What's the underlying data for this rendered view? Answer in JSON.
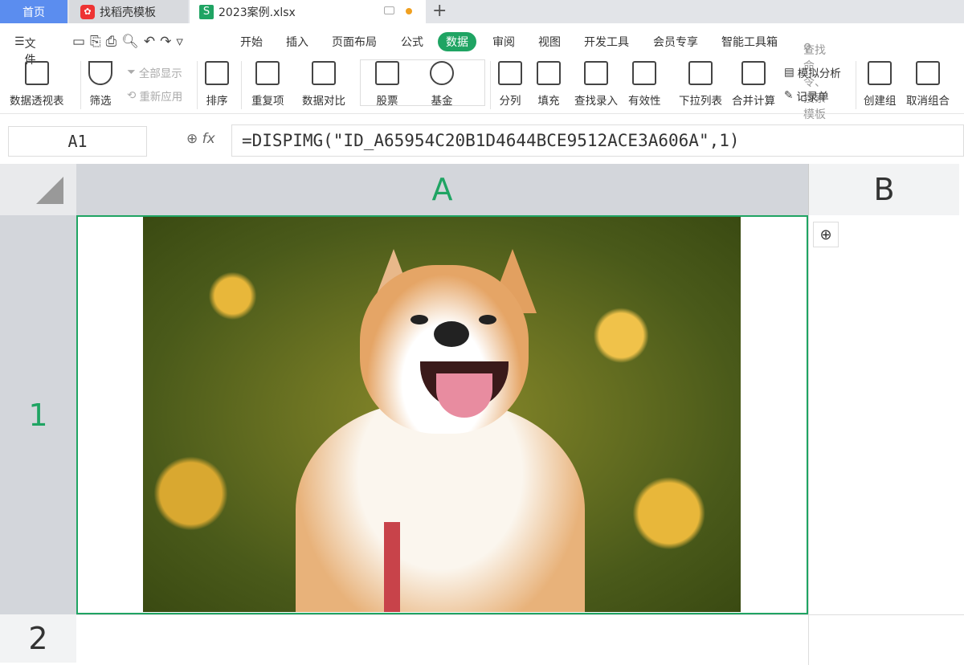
{
  "tabs": {
    "home": "首页",
    "template": "找稻壳模板",
    "file": "2023案例.xlsx",
    "file_icon": "S"
  },
  "menu": {
    "file": "文件",
    "items": [
      "开始",
      "插入",
      "页面布局",
      "公式",
      "数据",
      "审阅",
      "视图",
      "开发工具",
      "会员专享",
      "智能工具箱"
    ],
    "active": "数据",
    "search_placeholder": "查找命令、搜索模板"
  },
  "ribbon": {
    "pivot": "数据透视表",
    "filter": "筛选",
    "show_all": "全部显示",
    "reapply": "重新应用",
    "sort": "排序",
    "duplicates": "重复项",
    "compare": "数据对比",
    "stock": "股票",
    "fund": "基金",
    "split": "分列",
    "fill": "填充",
    "lookup": "查找录入",
    "validity": "有效性",
    "dropdown": "下拉列表",
    "consolidate": "合并计算",
    "whatif": "模拟分析",
    "record": "记录单",
    "group": "创建组",
    "ungroup": "取消组合"
  },
  "formula_bar": {
    "cell_ref": "A1",
    "fx": "fx",
    "formula": "=DISPIMG(\"ID_A65954C20B1D4644BCE9512ACE3A606A\",1)"
  },
  "sheet": {
    "columns": [
      "A",
      "B"
    ],
    "rows": [
      "1",
      "2"
    ]
  }
}
